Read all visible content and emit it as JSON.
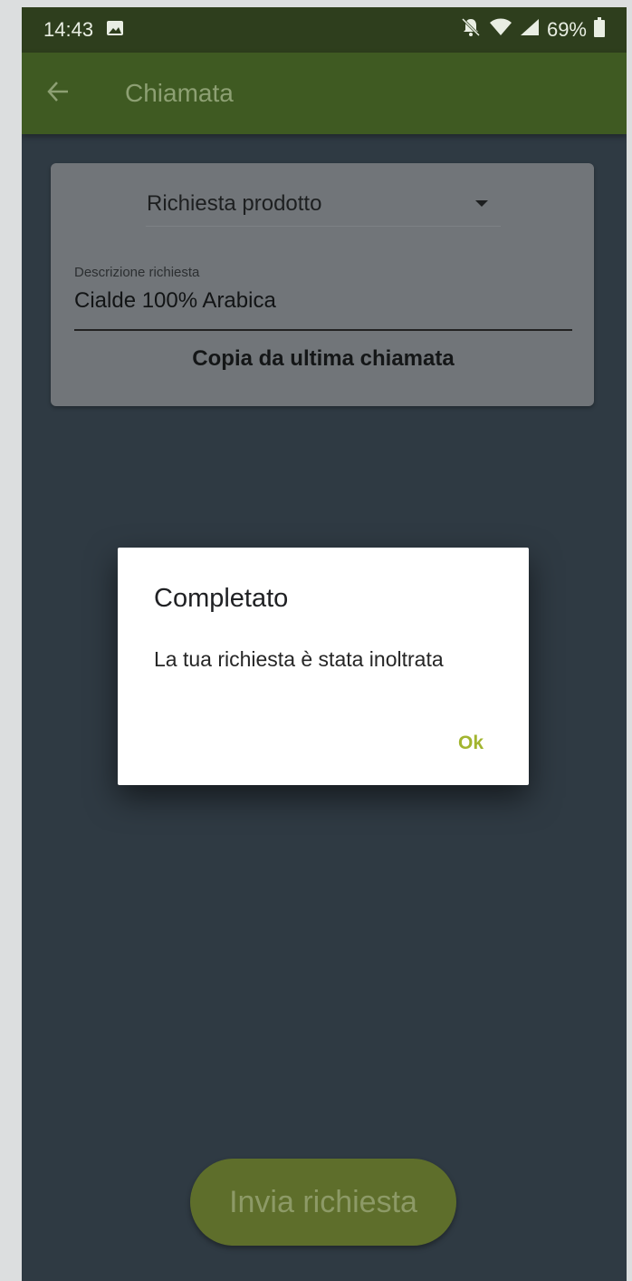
{
  "status_bar": {
    "time": "14:43",
    "battery": "69%",
    "icons": [
      "image-icon",
      "bell-off-icon",
      "wifi-icon",
      "signal-icon",
      "battery-icon"
    ]
  },
  "app_bar": {
    "title": "Chiamata",
    "back_icon": "arrow-left-icon"
  },
  "form": {
    "request_type": "Richiesta prodotto",
    "description_label": "Descrizione richiesta",
    "description_value": "Cialde 100% Arabica",
    "copy_button": "Copia da ultima chiamata",
    "submit_button": "Invia richiesta"
  },
  "dialog": {
    "title": "Completato",
    "message": "La tua richiesta è stata inoltrata",
    "ok_button": "Ok"
  },
  "colors": {
    "app_bar": "#3f5a22",
    "status_bar": "#2e3e1d",
    "background": "#2f3a43",
    "accent": "#a2b52f"
  }
}
